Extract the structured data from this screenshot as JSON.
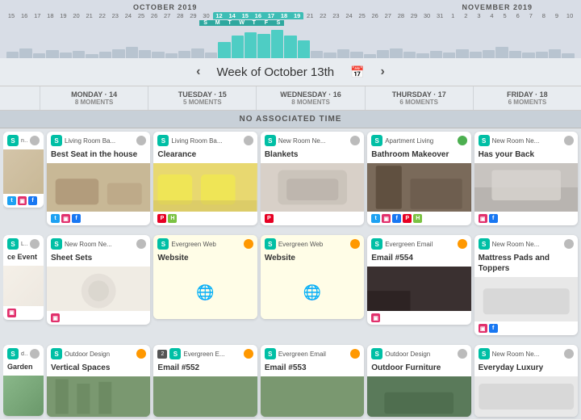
{
  "timeline": {
    "months": [
      {
        "label": "OCTOBER  2019",
        "position": "left"
      },
      {
        "label": "NOVEMBER  2019",
        "position": "right"
      }
    ],
    "numbers_oct": [
      "15",
      "16",
      "17",
      "18",
      "19",
      "20",
      "21",
      "22",
      "23",
      "24",
      "25",
      "26",
      "27",
      "28",
      "29",
      "30"
    ],
    "numbers_mid": [
      "1",
      "2",
      "3",
      "4",
      "5",
      "6",
      "7",
      "8",
      "9",
      "10"
    ],
    "numbers_nov": [
      "21",
      "22",
      "23",
      "24",
      "25",
      "26",
      "27",
      "28",
      "29",
      "30",
      "31",
      "1",
      "2",
      "3",
      "4",
      "5",
      "6",
      "7",
      "8",
      "9",
      "10"
    ],
    "week_label": "Week of October 13th"
  },
  "week_days": [
    {
      "day": "",
      "date": "13",
      "label": "MONDAY · 14",
      "moments": "8 MOMENTS"
    },
    {
      "day": "",
      "date": "14",
      "label": "TUESDAY · 15",
      "moments": "5 MOMENTS"
    },
    {
      "day": "",
      "date": "15",
      "label": "WEDNESDAY · 16",
      "moments": "8 MOMENTS"
    },
    {
      "day": "",
      "date": "16",
      "label": "THURSDAY · 17",
      "moments": "6 MOMENTS"
    },
    {
      "day": "",
      "date": "17",
      "label": "FRIDAY · 18",
      "moments": "6 MOMENTS"
    }
  ],
  "no_time_banner": "NO ASSOCIATED TIME",
  "nav": {
    "prev": "‹",
    "next": "›",
    "calendar_icon": "📅"
  },
  "cards": {
    "row1": [
      {
        "id": "c1",
        "channel": "S",
        "name": "Living Room Ba...",
        "title": "Best Seat in the house",
        "image_type": "room-bg",
        "socials": [
          "twitter",
          "instagram",
          "facebook"
        ],
        "dot": "gray",
        "partial": true
      },
      {
        "id": "c2",
        "channel": "S",
        "name": "Living Room Ba...",
        "title": "Clearance",
        "image_type": "yellow-chairs",
        "socials": [
          "pinterest",
          "houzz"
        ],
        "dot": "gray"
      },
      {
        "id": "c3",
        "channel": "S",
        "name": "New Room Ne...",
        "title": "Blankets",
        "image_type": "blankets",
        "socials": [
          "pinterest"
        ],
        "dot": "gray"
      },
      {
        "id": "c4",
        "channel": "S",
        "name": "Apartment Living",
        "title": "Bathroom Makeover",
        "image_type": "apartment",
        "socials": [
          "twitter",
          "instagram",
          "facebook",
          "pinterest",
          "houzz"
        ],
        "dot": "green"
      },
      {
        "id": "c5",
        "channel": "S",
        "name": "New Room Ne...",
        "title": "Has your Back",
        "image_type": "bedroom",
        "socials": [
          "instagram",
          "facebook"
        ],
        "dot": "gray"
      }
    ],
    "row2": [
      {
        "id": "c6",
        "channel": "S",
        "name": "Living",
        "title": "ce Event",
        "image_type": "sheets",
        "socials": [
          "instagram"
        ],
        "dot": "gray",
        "partial": true,
        "title_partial": "ce Event"
      },
      {
        "id": "c7",
        "channel": "S",
        "name": "New Room Ne...",
        "title": "Sheet Sets",
        "image_type": "sheets",
        "socials": [
          "instagram"
        ],
        "dot": "gray"
      },
      {
        "id": "c8",
        "channel": "S",
        "name": "Evergreen Web",
        "title": "Website",
        "image_type": "yellow-website",
        "socials": [],
        "dot": "orange",
        "yellow": true
      },
      {
        "id": "c9",
        "channel": "S",
        "name": "Evergreen Web",
        "title": "Website",
        "image_type": "yellow-website",
        "socials": [],
        "dot": "orange",
        "yellow": true
      },
      {
        "id": "c10",
        "channel": "S",
        "name": "Evergreen Email",
        "title": "Email #554",
        "image_type": "dark-room",
        "socials": [
          "instagram"
        ],
        "dot": "orange"
      },
      {
        "id": "c11",
        "channel": "S",
        "name": "New Room Ne...",
        "title": "Mattress Pads and Toppers",
        "image_type": "mattress",
        "socials": [
          "instagram",
          "facebook"
        ],
        "dot": "gray"
      }
    ],
    "row3": [
      {
        "id": "c12",
        "channel": "S",
        "name": "design",
        "title": "Garden",
        "image_type": "garden",
        "socials": [],
        "dot": "gray",
        "partial": true
      },
      {
        "id": "c13",
        "channel": "S",
        "name": "Outdoor Design",
        "title": "Vertical Spaces",
        "image_type": "garden",
        "socials": [],
        "dot": "orange"
      },
      {
        "id": "c14",
        "num": "2",
        "channel": "S",
        "name": "Evergreen E...",
        "title": "Email #552",
        "image_type": "garden",
        "socials": [],
        "dot": "orange"
      },
      {
        "id": "c15",
        "channel": "S",
        "name": "Evergreen Email",
        "title": "Email #553",
        "image_type": "garden",
        "socials": [],
        "dot": "orange"
      },
      {
        "id": "c16",
        "channel": "S",
        "name": "Outdoor Design",
        "title": "Outdoor Furniture",
        "image_type": "outdoor",
        "socials": [],
        "dot": "gray"
      },
      {
        "id": "c17",
        "channel": "S",
        "name": "New Room Ne...",
        "title": "Everyday Luxury",
        "image_type": "mattress",
        "socials": [],
        "dot": "gray"
      }
    ]
  }
}
